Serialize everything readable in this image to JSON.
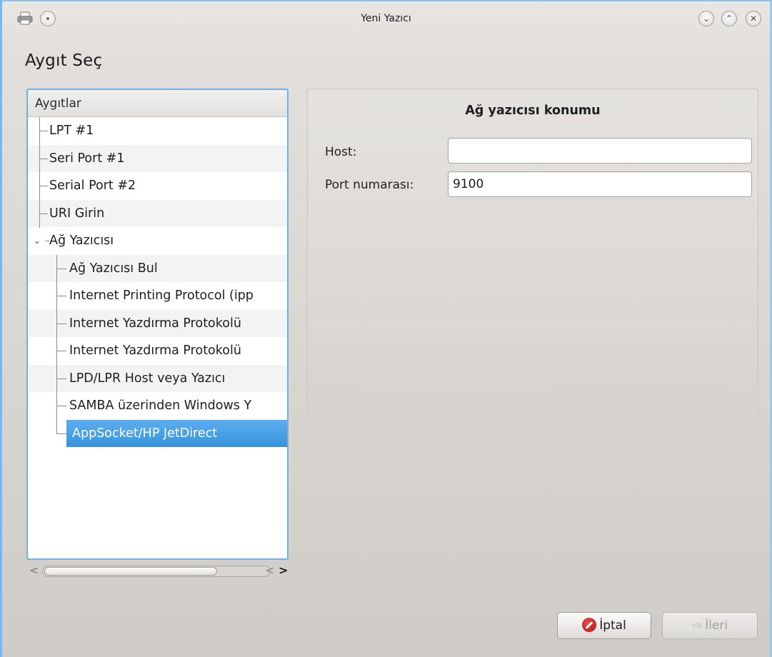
{
  "window": {
    "title": "Yeni Yazıcı",
    "controls": {
      "minimize": "⌄",
      "maximize": "⌃",
      "close": "✕"
    }
  },
  "page": {
    "title": "Aygıt Seç"
  },
  "device_tree": {
    "header": "Aygıtlar",
    "items": [
      {
        "label": "LPT #1",
        "level": 0
      },
      {
        "label": "Seri Port #1",
        "level": 0
      },
      {
        "label": "Serial Port #2",
        "level": 0
      },
      {
        "label": "URI Girin",
        "level": 0
      },
      {
        "label": "Ağ Yazıcısı",
        "level": 0,
        "expanded": true
      },
      {
        "label": "Ağ Yazıcısı Bul",
        "level": 1
      },
      {
        "label": "Internet Printing Protocol (ipp",
        "level": 1
      },
      {
        "label": "Internet Yazdırma Protokolü",
        "level": 1
      },
      {
        "label": "Internet Yazdırma Protokolü",
        "level": 1
      },
      {
        "label": "LPD/LPR Host veya Yazıcı",
        "level": 1
      },
      {
        "label": "SAMBA üzerinden Windows Y",
        "level": 1
      },
      {
        "label": "AppSocket/HP JetDirect",
        "level": 1,
        "selected": true
      }
    ]
  },
  "location": {
    "title": "Ağ yazıcısı konumu",
    "host_label": "Host:",
    "host_value": "",
    "port_label": "Port numarası:",
    "port_value": "9100"
  },
  "buttons": {
    "cancel": "İptal",
    "next": "İleri"
  },
  "colors": {
    "selection": "#3d9ae0",
    "window_border": "#78b8ea",
    "cancel_icon": "#c21818"
  }
}
